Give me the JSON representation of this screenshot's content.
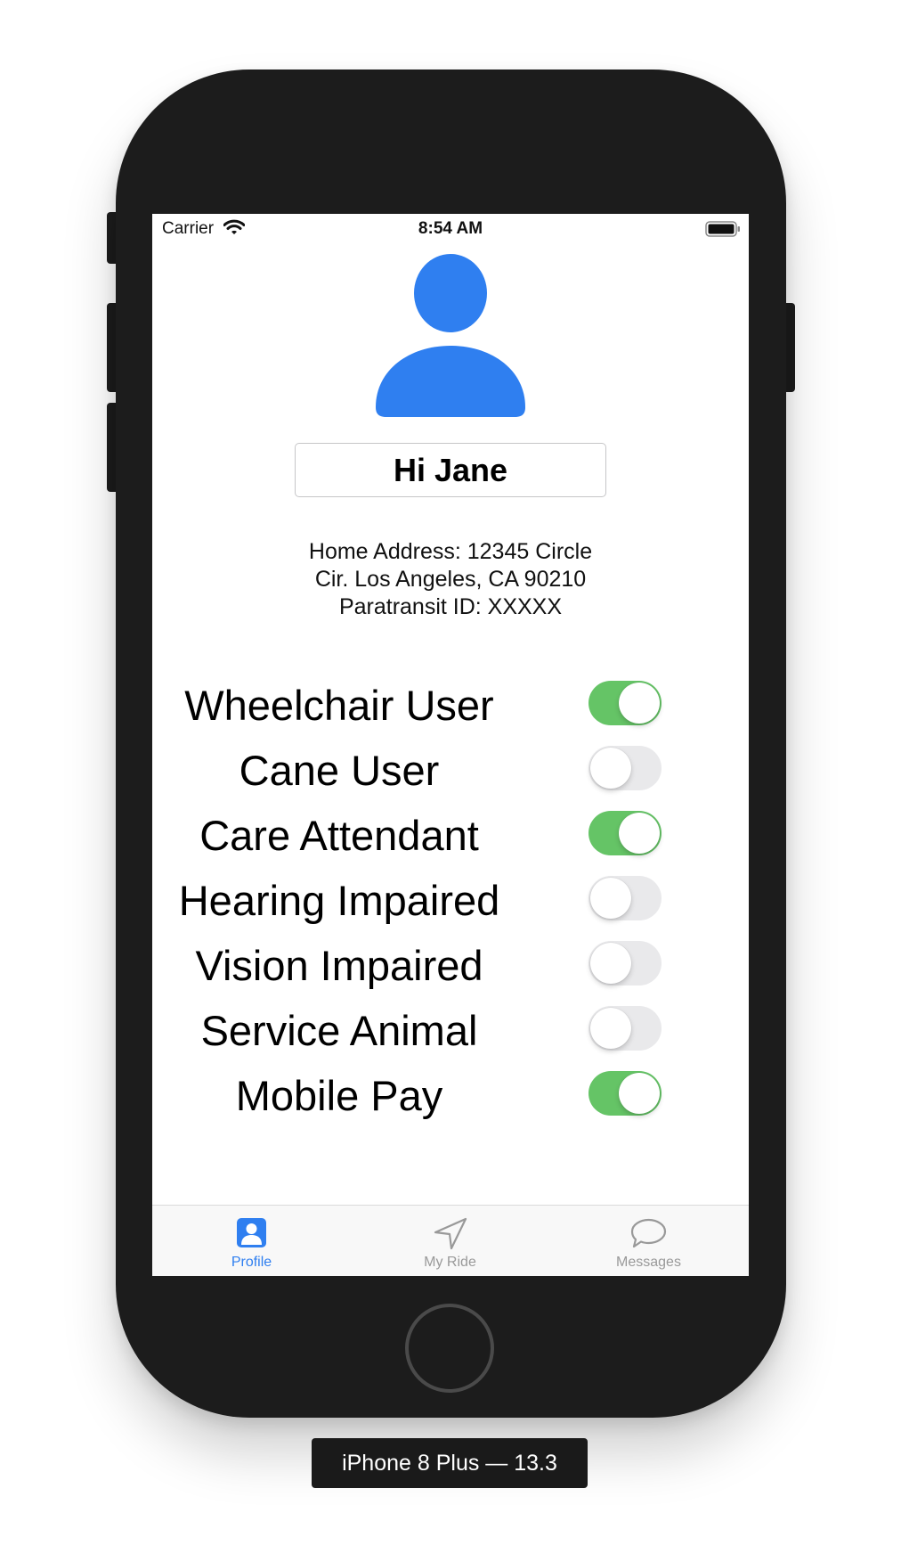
{
  "status_bar": {
    "carrier": "Carrier",
    "time": "8:54 AM",
    "wifi_icon": "wifi-icon",
    "battery_icon": "battery-full-icon"
  },
  "profile": {
    "avatar_icon": "person-icon",
    "greeting": "Hi Jane",
    "address_lines": [
      "Home Address: 12345 Circle",
      "Cir. Los Angeles, CA 90210",
      "Paratransit ID: XXXXX"
    ]
  },
  "toggles": [
    {
      "label": "Wheelchair User",
      "on": true
    },
    {
      "label": "Cane User",
      "on": false
    },
    {
      "label": "Care Attendant",
      "on": true
    },
    {
      "label": "Hearing Impaired",
      "on": false
    },
    {
      "label": "Vision Impaired",
      "on": false
    },
    {
      "label": "Service Animal",
      "on": false
    },
    {
      "label": "Mobile Pay",
      "on": true
    }
  ],
  "tabs": [
    {
      "label": "Profile",
      "icon": "profile-icon",
      "active": true
    },
    {
      "label": "My Ride",
      "icon": "location-arrow-icon",
      "active": false
    },
    {
      "label": "Messages",
      "icon": "chat-bubble-icon",
      "active": false
    }
  ],
  "device_label": "iPhone 8 Plus — 13.3",
  "colors": {
    "accent": "#2f7ff0",
    "switch_on": "#65c466",
    "switch_off": "#e9e9eb",
    "tab_inactive": "#999999"
  }
}
